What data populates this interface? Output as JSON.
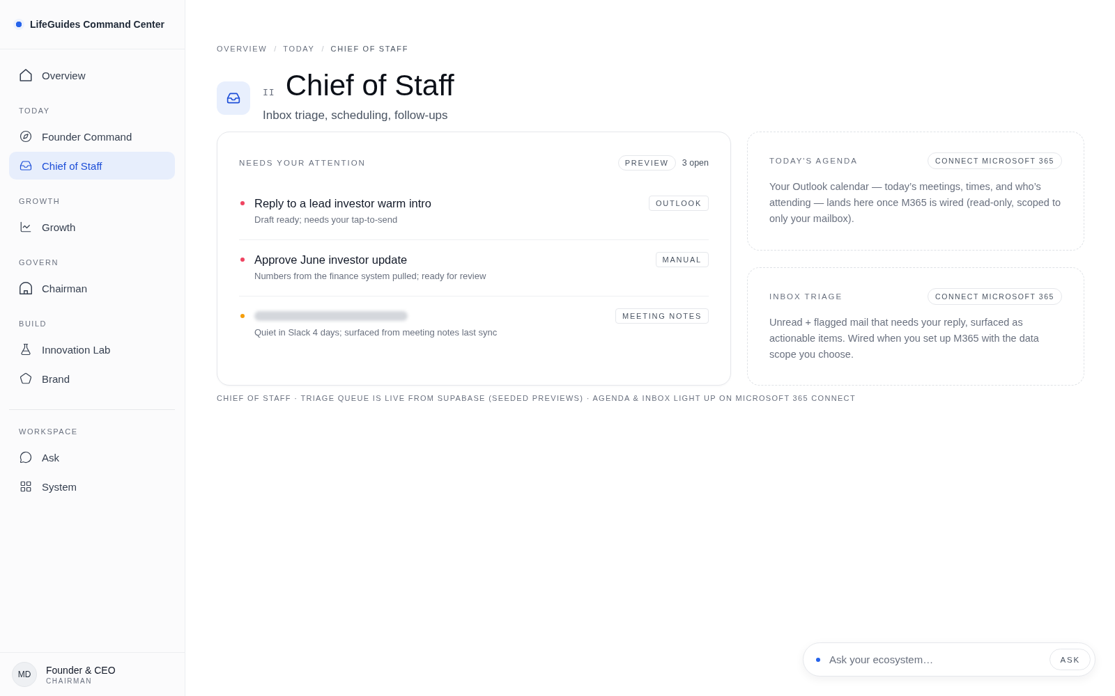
{
  "sidebar": {
    "brand": "LifeGuides Command Center",
    "nav_groups": [
      {
        "sections": [
          {
            "items": [
              {
                "label": "Overview",
                "selected": false
              }
            ]
          },
          {
            "heading": "TODAY",
            "items": [
              {
                "label": "Founder Command",
                "selected": false
              },
              {
                "label": "Chief of Staff",
                "selected": true
              }
            ]
          },
          {
            "heading": "GROWTH",
            "items": [
              {
                "label": "Growth",
                "selected": false
              }
            ]
          },
          {
            "heading": "GOVERN",
            "items": [
              {
                "label": "Chairman",
                "selected": false
              }
            ]
          },
          {
            "heading": "BUILD",
            "items": [
              {
                "label": "Innovation Lab",
                "selected": false
              },
              {
                "label": "Brand",
                "selected": false
              }
            ]
          }
        ]
      },
      {
        "sections": [
          {
            "heading": "WORKSPACE",
            "items": [
              {
                "label": "Ask",
                "selected": false
              },
              {
                "label": "System",
                "selected": false
              }
            ]
          }
        ]
      }
    ],
    "user": {
      "initials": "MD",
      "name": "Founder & CEO",
      "role": "CHAIRMAN"
    }
  },
  "breadcrumb": [
    {
      "kind": "link",
      "text": "OVERVIEW"
    },
    {
      "kind": "separator",
      "text": "/"
    },
    {
      "kind": "link",
      "text": "TODAY"
    },
    {
      "kind": "separator",
      "text": "/"
    },
    {
      "kind": "current",
      "text": "CHIEF OF STAFF"
    }
  ],
  "header": {
    "number": "II",
    "title": "Chief of Staff",
    "subtitle": "Inbox triage, scheduling, follow-ups"
  },
  "attention": {
    "heading": "NEEDS YOUR ATTENTION",
    "badge": "PREVIEW",
    "count": "3 open",
    "items": [
      {
        "title": "Reply to a lead investor warm intro",
        "blurred": false,
        "detail": "Draft ready; needs your tap-to-send",
        "source": "OUTLOOK",
        "color": "#ef4461"
      },
      {
        "title": "Approve June investor update",
        "blurred": false,
        "detail": "Numbers from the finance system pulled; ready for review",
        "source": "MANUAL",
        "color": "#ef4461"
      },
      {
        "blurred": true,
        "detail": "Quiet in Slack 4 days; surfaced from meeting notes last sync",
        "source": "MEETING NOTES",
        "color": "#f59e0b"
      }
    ]
  },
  "panels": [
    {
      "heading": "TODAY'S AGENDA",
      "action": "CONNECT MICROSOFT 365",
      "body": "Your Outlook calendar — today’s meetings, times, and who’s attending — lands here once M365 is wired (read-only, scoped to only your mailbox)."
    },
    {
      "heading": "INBOX TRIAGE",
      "action": "CONNECT MICROSOFT 365",
      "body": "Unread + flagged mail that needs your reply, surfaced as actionable items. Wired when you set up M365 with the data scope you choose."
    }
  ],
  "footnote": "CHIEF OF STAFF · TRIAGE QUEUE IS LIVE FROM SUPABASE (SEEDED PREVIEWS) · AGENDA & INBOX LIGHT UP ON MICROSOFT 365 CONNECT",
  "ask_bar": {
    "placeholder": "Ask your ecosystem…",
    "button": "ASK"
  }
}
